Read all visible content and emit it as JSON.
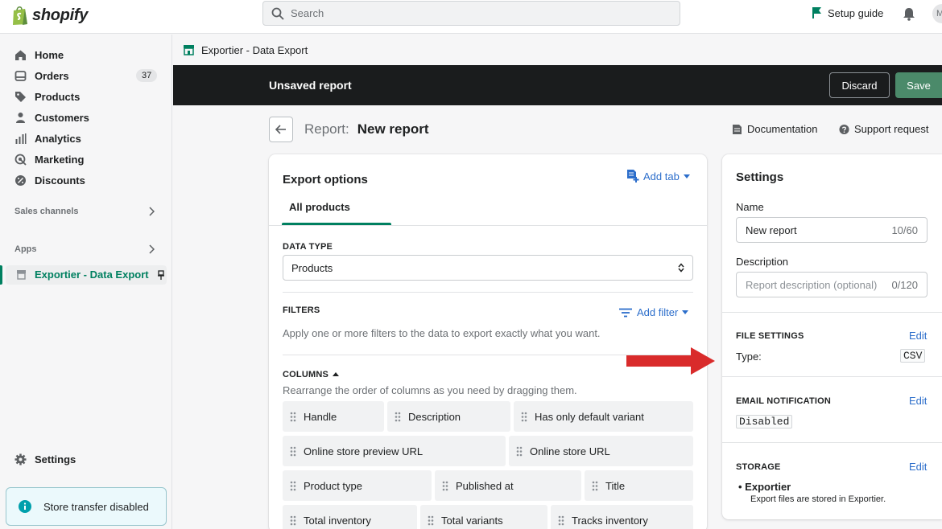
{
  "topbar": {
    "brand": "shopify",
    "search_placeholder": "Search",
    "setup_guide": "Setup guide",
    "avatar_initial": "M"
  },
  "sidebar": {
    "items": [
      {
        "label": "Home",
        "icon": "home-icon"
      },
      {
        "label": "Orders",
        "icon": "orders-icon",
        "badge": "37"
      },
      {
        "label": "Products",
        "icon": "tag-icon"
      },
      {
        "label": "Customers",
        "icon": "person-icon"
      },
      {
        "label": "Analytics",
        "icon": "bar-chart-icon"
      },
      {
        "label": "Marketing",
        "icon": "target-icon"
      },
      {
        "label": "Discounts",
        "icon": "discount-icon"
      }
    ],
    "sales_channels": "Sales channels",
    "apps": "Apps",
    "app_item": "Exportier - Data Export",
    "settings": "Settings",
    "store_transfer": "Store transfer disabled"
  },
  "breadcrumb": "Exportier - Data Export",
  "contextbar": {
    "title": "Unsaved report",
    "discard": "Discard",
    "save": "Save"
  },
  "page": {
    "title_label": "Report:",
    "title_value": "New report",
    "documentation": "Documentation",
    "support": "Support request"
  },
  "export": {
    "title": "Export options",
    "add_tab": "Add tab",
    "tab": "All products",
    "data_type_label": "DATA TYPE",
    "data_type_value": "Products",
    "filters_label": "FILTERS",
    "add_filter": "Add filter",
    "filters_help": "Apply one or more filters to the data to export exactly what you want.",
    "columns_label": "COLUMNS",
    "columns_help": "Rearrange the order of columns as you need by dragging them.",
    "columns": [
      "Handle",
      "Description",
      "Has only default variant",
      "Online store preview URL",
      "Online store URL",
      "Product type",
      "Published at",
      "Title",
      "Total inventory",
      "Total variants",
      "Tracks inventory"
    ]
  },
  "settings": {
    "title": "Settings",
    "name_label": "Name",
    "name_value": "New report",
    "name_count": "10/60",
    "desc_label": "Description",
    "desc_placeholder": "Report description (optional)",
    "desc_count": "0/120",
    "file_settings": "FILE SETTINGS",
    "file_edit": "Edit",
    "type_label": "Type:",
    "type_value": "CSV",
    "email_notification": "EMAIL NOTIFICATION",
    "email_edit": "Edit",
    "email_value": "Disabled",
    "storage": "STORAGE",
    "storage_edit": "Edit",
    "storage_item": "Exportier",
    "storage_sub": "Export files are stored in Exportier."
  },
  "colors": {
    "accent_green": "#008060",
    "link_blue": "#2c6ecb",
    "annotation_red": "#d92b2b",
    "dark_bar": "#1a1c1d"
  }
}
